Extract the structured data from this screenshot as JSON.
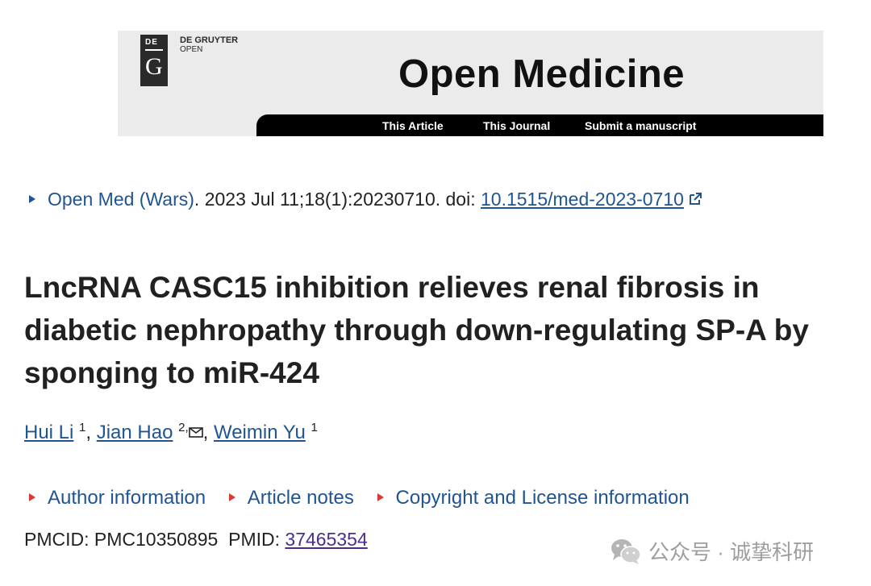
{
  "banner": {
    "logo_de": "DE",
    "logo_g": "G",
    "publisher_line1": "DE GRUYTER",
    "publisher_line2": "OPEN",
    "journal_title": "Open Medicine",
    "nav": [
      "This Article",
      "This Journal",
      "Submit a manuscript"
    ]
  },
  "citation": {
    "journal_link": "Open Med (Wars)",
    "details": ". 2023 Jul 11;18(1):20230710. doi: ",
    "doi": "10.1515/med-2023-0710"
  },
  "title": "LncRNA CASC15 inhibition relieves renal fibrosis in diabetic nephropathy through down-regulating SP-A by sponging to miR-424",
  "authors": [
    {
      "name": "Hui Li",
      "sup": "1"
    },
    {
      "name": "Jian Hao",
      "sup": "2,"
    },
    {
      "name": "Weimin Yu",
      "sup": "1"
    }
  ],
  "expanders": [
    "Author information",
    "Article notes",
    "Copyright and License information"
  ],
  "ids": {
    "pmcid_label": "PMCID: PMC10350895",
    "pmid_label": "PMID: ",
    "pmid": "37465354"
  },
  "watermark": "公众号 · 诚挚科研",
  "colors": {
    "link_blue": "#205493",
    "visited_purple": "#4c2c92",
    "marker_red": "#d83933",
    "nav_black": "#000000",
    "banner_gray": "#ebebeb"
  },
  "icons": [
    "external-link-icon",
    "mail-icon",
    "wechat-icon"
  ]
}
